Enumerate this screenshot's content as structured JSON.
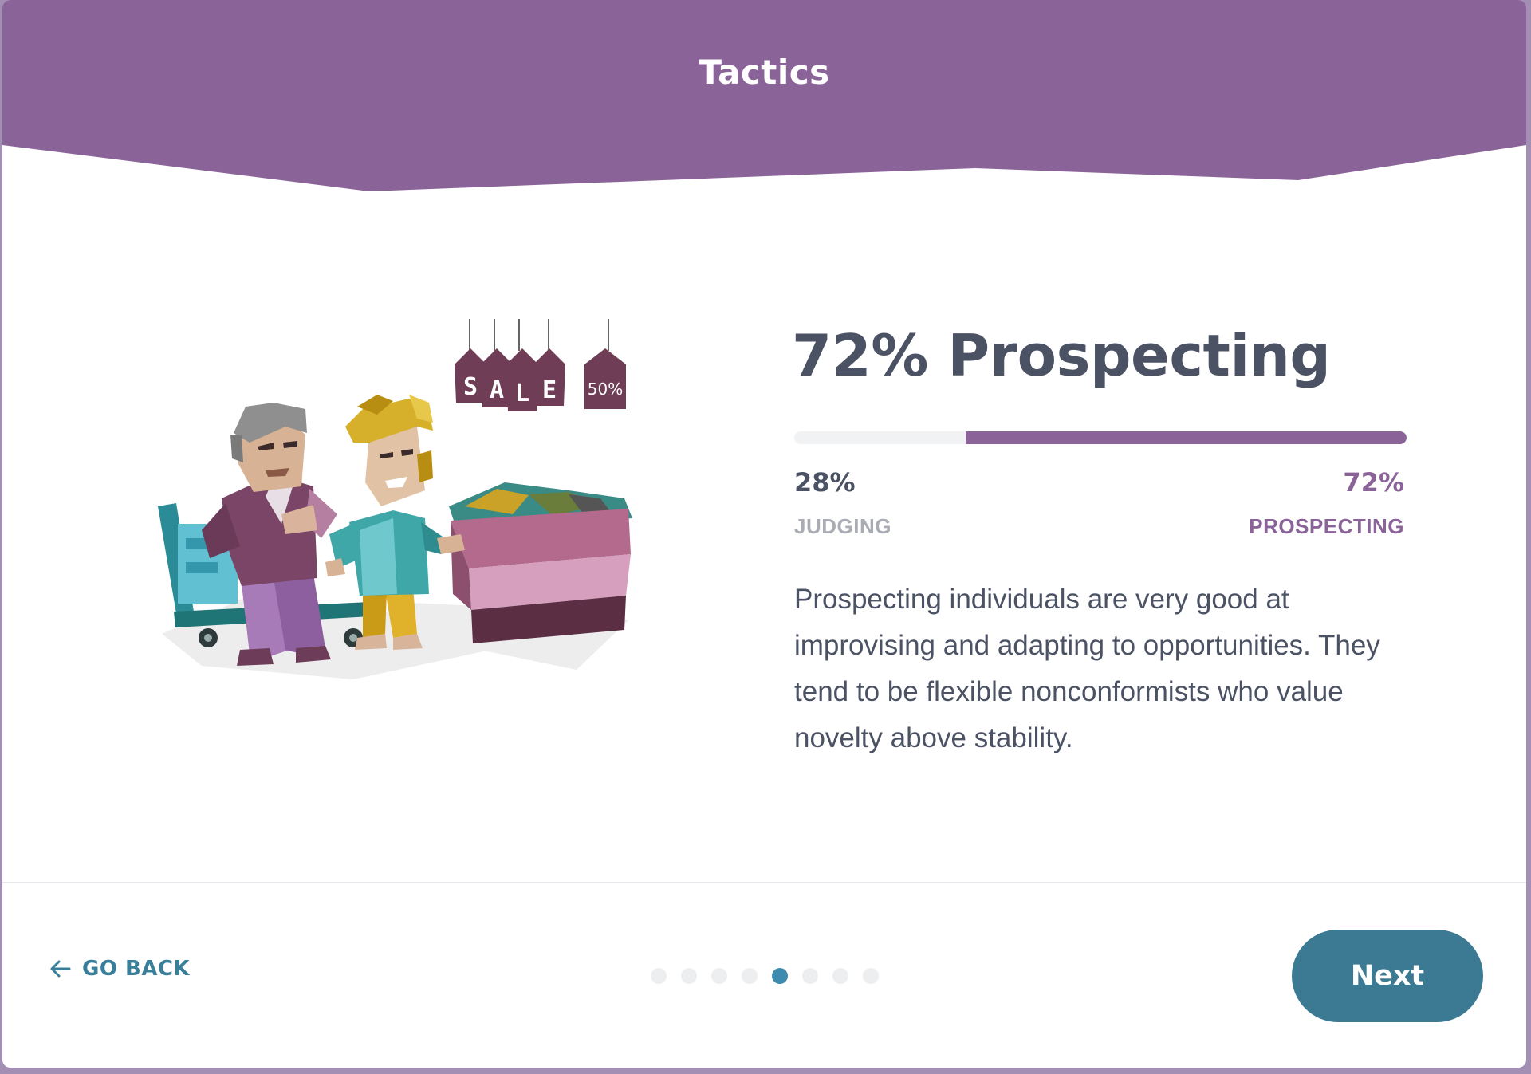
{
  "header": {
    "title": "Tactics"
  },
  "trait": {
    "title": "72% Prospecting",
    "left_percent": "28%",
    "left_label": "JUDGING",
    "right_percent": "72%",
    "right_label": "PROSPECTING",
    "right_share": 72,
    "description": "Prospecting individuals are very good at improvising and adapting to opportunities. They tend to be flexible nonconformists who value novelty above stability."
  },
  "illustration": {
    "sale_tags": [
      "S",
      "A",
      "L",
      "E"
    ],
    "discount_tag": "50%"
  },
  "footer": {
    "back_label": "GO BACK",
    "next_label": "Next",
    "pagination": {
      "total": 8,
      "current": 5
    }
  },
  "colors": {
    "brand_purple": "#8a6399",
    "accent_teal": "#3b7a92",
    "text_dark": "#4b5264",
    "text_muted": "#a9acb3"
  }
}
